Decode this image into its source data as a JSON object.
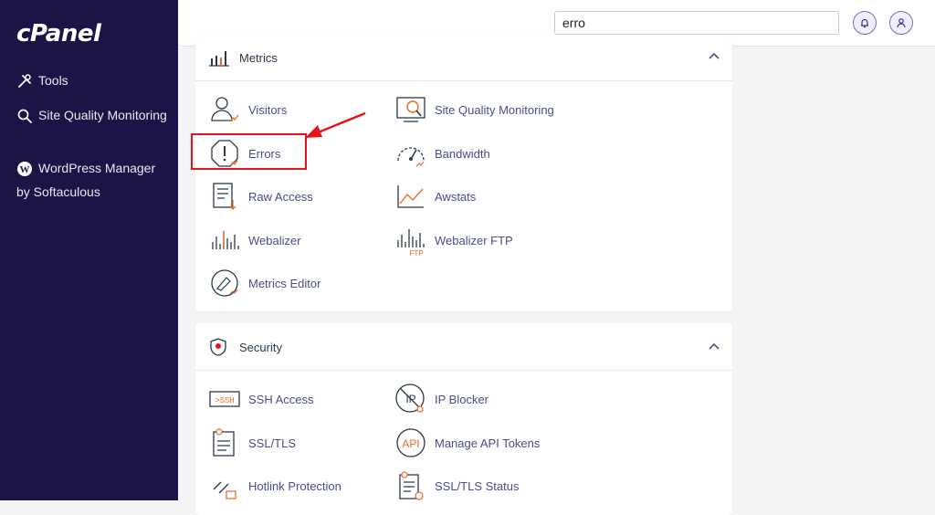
{
  "sidebar": {
    "logo": "cPanel",
    "items": [
      {
        "label": "Tools",
        "icon": "tools-icon"
      },
      {
        "label": "Site Quality Monitoring",
        "icon": "search-icon"
      },
      {
        "label": "WordPress Manager by Softaculous",
        "icon": "wordpress-icon"
      }
    ]
  },
  "header": {
    "search_value": "erro",
    "notifications_icon": "bell-icon",
    "user_icon": "user-icon"
  },
  "metrics": {
    "title": "Metrics",
    "tools": [
      {
        "label": "Visitors",
        "icon": "visitors-icon"
      },
      {
        "label": "Site Quality Monitoring",
        "icon": "site-quality-icon"
      },
      {
        "label": "Errors",
        "icon": "errors-icon"
      },
      {
        "label": "Bandwidth",
        "icon": "bandwidth-icon"
      },
      {
        "label": "Raw Access",
        "icon": "raw-access-icon"
      },
      {
        "label": "Awstats",
        "icon": "awstats-icon"
      },
      {
        "label": "Webalizer",
        "icon": "webalizer-icon"
      },
      {
        "label": "Webalizer FTP",
        "icon": "webalizer-ftp-icon"
      },
      {
        "label": "Metrics Editor",
        "icon": "metrics-editor-icon"
      }
    ]
  },
  "security": {
    "title": "Security",
    "tools": [
      {
        "label": "SSH Access",
        "icon": "ssh-icon"
      },
      {
        "label": "IP Blocker",
        "icon": "ip-blocker-icon"
      },
      {
        "label": "SSL/TLS",
        "icon": "ssl-icon"
      },
      {
        "label": "Manage API Tokens",
        "icon": "api-icon"
      },
      {
        "label": "Hotlink Protection",
        "icon": "hotlink-icon"
      },
      {
        "label": "SSL/TLS Status",
        "icon": "ssl-status-icon"
      }
    ]
  },
  "colors": {
    "sidebar_bg": "#1c1446",
    "accent_orange": "#f26522",
    "link": "#4a4d8c",
    "highlight_red": "#e4161b"
  }
}
